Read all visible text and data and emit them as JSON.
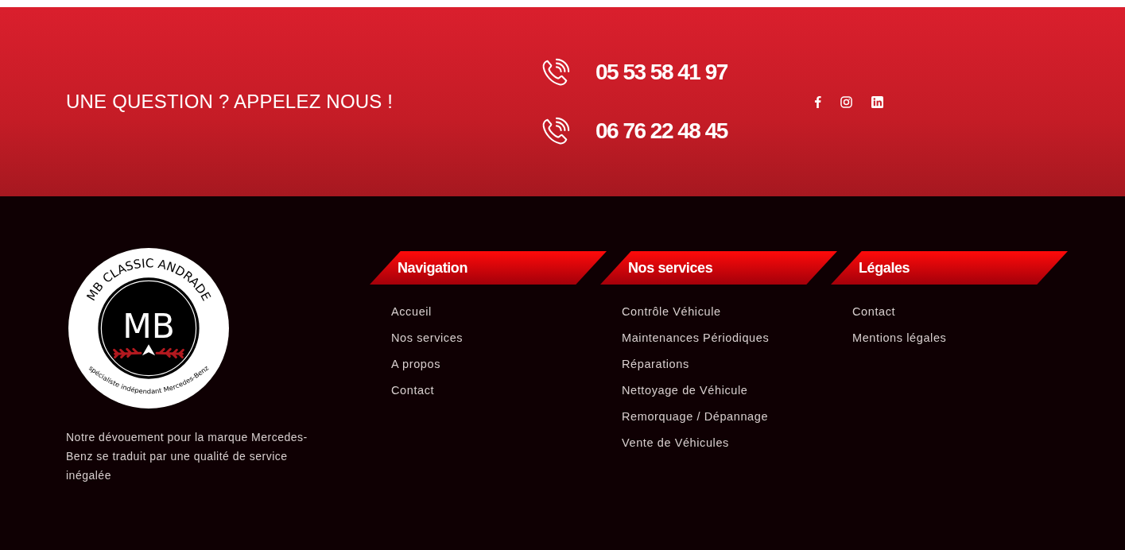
{
  "call_banner": {
    "heading": "UNE QUESTION ? APPELEZ NOUS !",
    "phones": [
      "05 53 58 41 97",
      "06 76 22 48 45"
    ],
    "social": [
      {
        "kind": "facebook"
      },
      {
        "kind": "instagram"
      },
      {
        "kind": "linkedin"
      }
    ]
  },
  "footer": {
    "logo": {
      "arc_top": "MB CLASSIC ANDRADE",
      "monogram": "MB",
      "arc_bottom": "spécialiste indépendant Mercedes-Benz"
    },
    "tagline": "Notre dévouement pour la marque Mercedes-Benz se traduit par une qualité de service inégalée",
    "columns": [
      {
        "title": "Navigation",
        "links": [
          "Accueil",
          "Nos services",
          "A propos",
          "Contact"
        ]
      },
      {
        "title": "Nos services",
        "links": [
          "Contrôle Véhicule",
          "Maintenances Périodiques",
          "Réparations",
          "Nettoyage de Véhicule",
          "Remorquage / Dépannage",
          "Vente de Véhicules"
        ]
      },
      {
        "title": "Légales",
        "links": [
          "Contact",
          "Mentions légales"
        ]
      }
    ]
  }
}
